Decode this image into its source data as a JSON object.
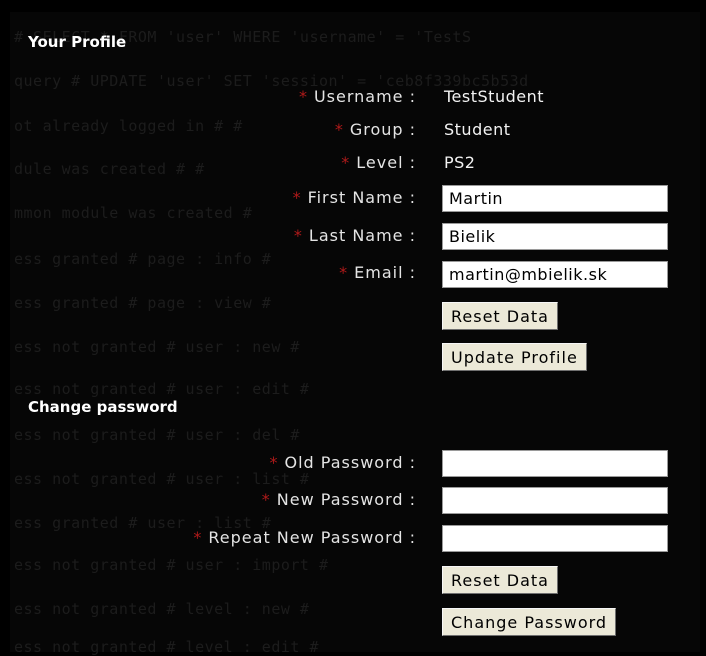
{
  "background_text": [
    "# SELECT * FROM 'user' WHERE 'username' = 'TestS",
    "query # UPDATE 'user' SET 'session' = 'ceb8f339bc5b53d",
    "ot already logged in #  # ",
    "dule was created #  #",
    "mmon module was created #",
    "ess granted # page : info #",
    "ess granted # page : view #",
    "ess not granted # user : new #",
    "ess not granted # user : edit #",
    "ess not granted # user : del #",
    "ess not granted # user : list #",
    "ess granted # user : list #",
    "ess not granted # user : import #",
    "ess not granted # level : new #",
    "ess not granted # level : edit #"
  ],
  "profile": {
    "title": "Your Profile",
    "required_mark": "*",
    "username": {
      "label": "Username :",
      "value": "TestStudent"
    },
    "group": {
      "label": "Group :",
      "value": "Student"
    },
    "level": {
      "label": "Level :",
      "value": "PS2"
    },
    "first_name": {
      "label": "First Name :",
      "value": "Martin"
    },
    "last_name": {
      "label": "Last Name :",
      "value": "Bielik"
    },
    "email": {
      "label": "Email :",
      "value": "martin@mbielik.sk"
    },
    "reset_label": "Reset Data",
    "update_label": "Update Profile"
  },
  "password": {
    "title": "Change password",
    "old": {
      "label": "Old Password :",
      "value": ""
    },
    "new": {
      "label": "New Password :",
      "value": ""
    },
    "repeat": {
      "label": "Repeat New Password :",
      "value": ""
    },
    "reset_label": "Reset Data",
    "change_label": "Change Password"
  },
  "colors": {
    "background": "#000000",
    "required_mark": "#b01a1a",
    "button_face": "#ece9d8"
  }
}
